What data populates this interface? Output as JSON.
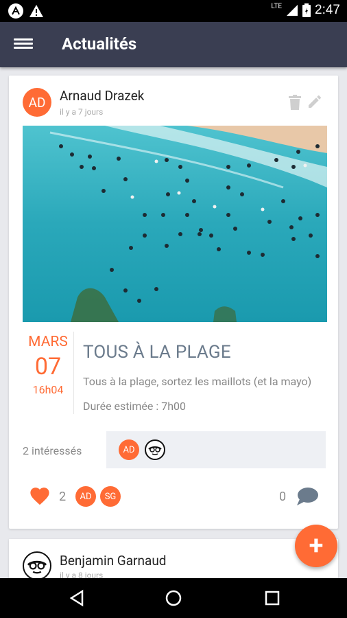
{
  "status_bar": {
    "time": "2:47",
    "network": "LTE",
    "icons": [
      "app-notification-icon",
      "warning-icon",
      "signal-icon",
      "battery-icon"
    ]
  },
  "app_bar": {
    "title": "Actualités",
    "menu_icon": "menu-icon"
  },
  "posts": [
    {
      "author_initials": "AD",
      "author": "Arnaud Drazek",
      "posted": "il y a 7 jours",
      "actions": [
        "delete-icon",
        "edit-icon"
      ],
      "event": {
        "month": "MARS",
        "day": "07",
        "time": "16h04",
        "title": "TOUS À LA PLAGE",
        "description": "Tous à la plage, sortez les maillots (et la mayo)",
        "duration": "Durée estimée : 7h00"
      },
      "interested_label": "2 intéressés",
      "interested": [
        "AD",
        "face-avatar"
      ],
      "likes": "2",
      "likers": [
        "AD",
        "SG"
      ],
      "comments": "0"
    },
    {
      "author": "Benjamin Garnaud",
      "posted": "il y a 8 jours"
    }
  ],
  "fab": {
    "icon": "plus-icon",
    "label": "+"
  },
  "colors": {
    "accent": "#ff6b35",
    "appbar": "#3a3e52",
    "background": "#e8e9ed",
    "title_text": "#6b7b8c"
  }
}
